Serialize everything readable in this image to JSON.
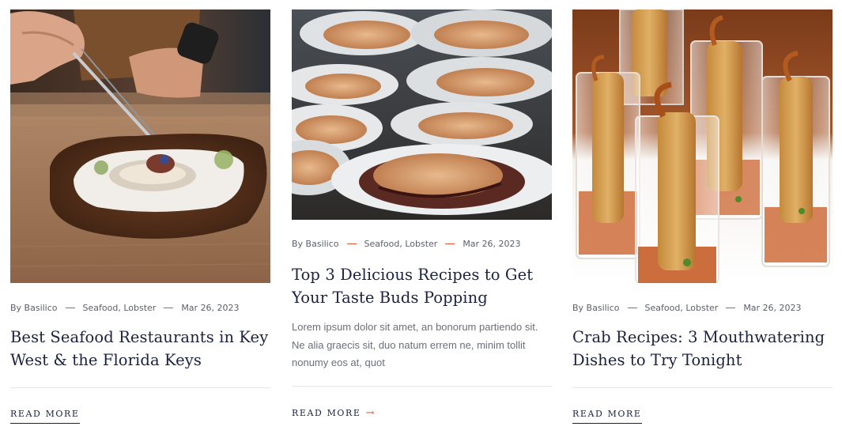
{
  "posts": [
    {
      "image_alt": "Chef plating an oyster with tweezers in a wooden bowl",
      "author": "By Basilico",
      "categories": "Seafood, Lobster",
      "date": "Mar 26, 2023",
      "title": "Best Seafood Restaurants in Key West & the Florida Keys",
      "read_more": "READ MORE"
    },
    {
      "image_alt": "Grilled mussels on the half shell",
      "author": "By Basilico",
      "categories": "Seafood, Lobster",
      "date": "Mar 26, 2023",
      "title": "Top 3 Delicious Recipes to Get Your Taste Buds Popping",
      "excerpt": "Lorem ipsum dolor sit amet, an bonorum partiendo sit. Ne alia graecis sit, duo natum errem ne, minim tollit nonumy eos at, quot",
      "read_more": "READ MORE",
      "arrow_icon": "arrow-right-icon"
    },
    {
      "image_alt": "Fried shrimp appetizers served in glasses",
      "author": "By Basilico",
      "categories": "Seafood, Lobster",
      "date": "Mar 26, 2023",
      "title": "Crab Recipes: 3 Mouthwatering Dishes to Try Tonight",
      "read_more": "READ MORE"
    }
  ],
  "colors": {
    "heading": "#1b2240",
    "meta": "#5b5f6b",
    "accent": "#e0532a",
    "divider": "#e6e6e6"
  }
}
